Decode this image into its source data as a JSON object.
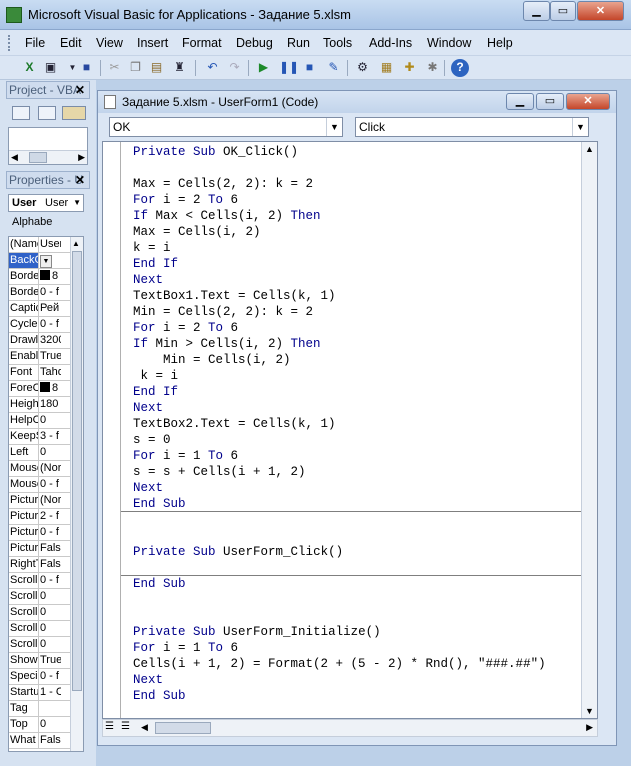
{
  "window": {
    "title": "Microsoft Visual Basic for Applications - Задание 5.xlsm"
  },
  "menu": [
    "File",
    "Edit",
    "View",
    "Insert",
    "Format",
    "Debug",
    "Run",
    "Tools",
    "Add-Ins",
    "Window",
    "Help"
  ],
  "toolbar_icons": [
    "excel-icon",
    "insert-userform-icon",
    "save-icon",
    "cut-icon",
    "copy-icon",
    "paste-icon",
    "find-icon",
    "undo-icon",
    "redo-icon",
    "run-icon",
    "break-icon",
    "reset-icon",
    "design-mode-icon",
    "project-explorer-icon",
    "properties-window-icon",
    "object-browser-icon",
    "toolbox-icon",
    "help-icon"
  ],
  "project_pane": {
    "title": "Project - VBA"
  },
  "properties_pane": {
    "title": "Properties - U",
    "object_name": "User",
    "object_type": "User",
    "tab": "Alphabe"
  },
  "properties": [
    {
      "name": "(Name",
      "value": "User"
    },
    {
      "name": "BackC",
      "value": ""
    },
    {
      "name": "Borde",
      "value": "8"
    },
    {
      "name": "Borde",
      "value": "0 - f"
    },
    {
      "name": "Captic",
      "value": "Рей"
    },
    {
      "name": "Cycle",
      "value": "0 - f"
    },
    {
      "name": "Drawl",
      "value": "3200"
    },
    {
      "name": "Enabl",
      "value": "True"
    },
    {
      "name": "Font",
      "value": "Taho"
    },
    {
      "name": "ForeC",
      "value": "8"
    },
    {
      "name": "Heigh",
      "value": "180"
    },
    {
      "name": "HelpC",
      "value": "0"
    },
    {
      "name": "KeepS",
      "value": "3 - f"
    },
    {
      "name": "Left",
      "value": "0"
    },
    {
      "name": "Mouse",
      "value": "(Nor"
    },
    {
      "name": "Mouse",
      "value": "0 - f"
    },
    {
      "name": "Pictur",
      "value": "(Nor"
    },
    {
      "name": "Pictur",
      "value": "2 - f"
    },
    {
      "name": "Pictur",
      "value": "0 - f"
    },
    {
      "name": "Pictur",
      "value": "Fals"
    },
    {
      "name": "RightT",
      "value": "Fals"
    },
    {
      "name": "Scroll",
      "value": "0 - f"
    },
    {
      "name": "Scroll",
      "value": "0"
    },
    {
      "name": "Scroll",
      "value": "0"
    },
    {
      "name": "Scroll",
      "value": "0"
    },
    {
      "name": "Scroll",
      "value": "0"
    },
    {
      "name": "Showl",
      "value": "True"
    },
    {
      "name": "Speci",
      "value": "0 - f"
    },
    {
      "name": "Startu",
      "value": "1 - C"
    },
    {
      "name": "Tag",
      "value": ""
    },
    {
      "name": "Top",
      "value": "0"
    },
    {
      "name": "What",
      "value": "Fals"
    }
  ],
  "code_window": {
    "title": "Задание 5.xlsm - UserForm1 (Code)",
    "object_combo": "OK",
    "procedure_combo": "Click"
  },
  "code_blocks": [
    [
      "Private Sub OK_Click()",
      "",
      "Max = Cells(2, 2): k = 2",
      "For i = 2 To 6",
      "If Max < Cells(i, 2) Then",
      "Max = Cells(i, 2)",
      "k = i",
      "End If",
      "Next",
      "TextBox1.Text = Cells(k, 1)",
      "Min = Cells(2, 2): k = 2",
      "For i = 2 To 6",
      "If Min > Cells(i, 2) Then",
      "    Min = Cells(i, 2)",
      " k = i",
      "End If",
      "Next",
      "TextBox2.Text = Cells(k, 1)",
      "s = 0",
      "For i = 1 To 6",
      "s = s + Cells(i + 1, 2)",
      "Next",
      "End Sub"
    ],
    [
      "",
      "Private Sub UserForm_Click()",
      "",
      "End Sub"
    ],
    [
      "",
      "Private Sub UserForm_Initialize()",
      "For i = 1 To 6",
      "Cells(i + 1, 2) = Format(2 + (5 - 2) * Rnd(), \"###.##\")",
      "Next",
      "End Sub"
    ]
  ],
  "keywords": [
    "Private",
    "Sub",
    "For",
    "To",
    "If",
    "Then",
    "End",
    "Next"
  ],
  "colors": {
    "keyword": "#00008b",
    "selection": "#3062c8"
  }
}
